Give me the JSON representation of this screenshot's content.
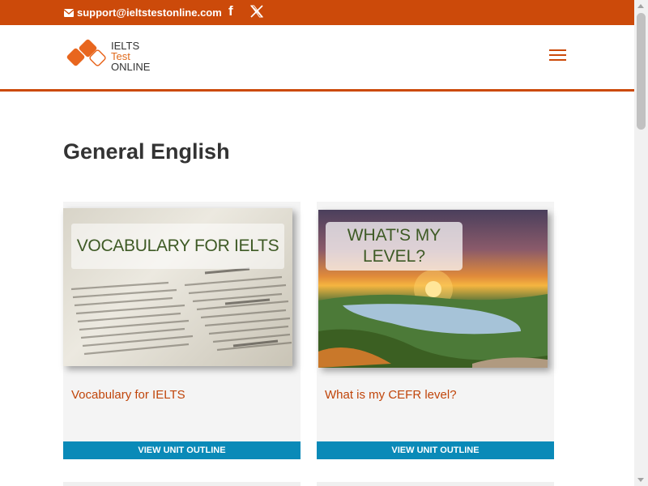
{
  "topbar": {
    "email": "support@ieltstestonline.com",
    "facebook_glyph": "f",
    "icons": [
      "mail-icon",
      "facebook-icon",
      "x-icon"
    ]
  },
  "header": {
    "logo": {
      "line1": "IELTS",
      "line2": "Test",
      "line3": "ONLINE"
    },
    "menu_icon": "hamburger-icon",
    "accent_color": "#cc4a0a"
  },
  "main": {
    "title": "General English",
    "cards": [
      {
        "image_label": "VOCABULARY FOR IELTS",
        "title": "Vocabulary for IELTS",
        "button": "VIEW UNIT OUTLINE"
      },
      {
        "image_label_line1": "WHAT'S MY",
        "image_label_line2": "LEVEL?",
        "title": "What is my CEFR level?",
        "button": "VIEW UNIT OUTLINE"
      }
    ]
  },
  "colors": {
    "brand_orange": "#cc4a0a",
    "button_blue": "#0a8ab8",
    "link_orange": "#c0450a"
  }
}
